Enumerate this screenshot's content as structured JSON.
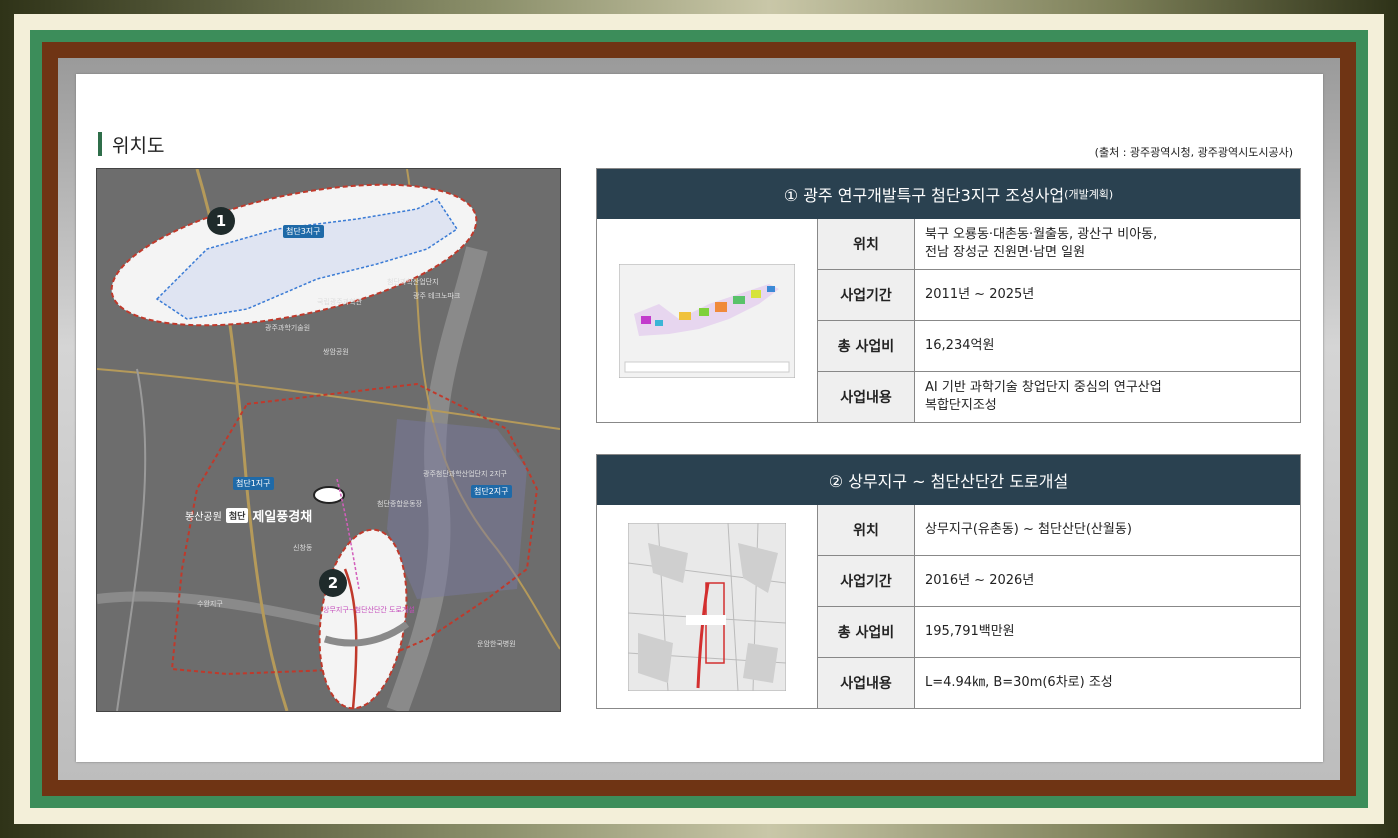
{
  "section": {
    "title": "위치도",
    "source": "(출처 : 광주광역시청, 광주광역시도시공사)"
  },
  "map": {
    "marker1": "1",
    "marker2": "2",
    "badges": {
      "zone3": "첨단3지구",
      "zone1": "첨단1지구",
      "zone2": "첨단2지구"
    },
    "location": {
      "park": "봉산공원",
      "tag": "첨단",
      "company": "제일풍경채"
    },
    "labels": {
      "l1": "국립광주과학관",
      "l2": "광주과학기술원",
      "l3": "첨단과학산업단지",
      "l4": "광주 테크노파크",
      "l5": "수완지구",
      "l6": "신창동",
      "l7": "운암한국병원",
      "l8": "첨단종합운동장",
      "l9": "쌍암공원",
      "l10": "광주첨단과학산업단지 2지구"
    },
    "project_label": "상무지구~첨단산단간 도로개설"
  },
  "projects": [
    {
      "title": "① 광주 연구개발특구 첨단3지구 조성사업",
      "title_note": "(개발계획)",
      "rows": [
        {
          "label": "위치",
          "value": "북구 오룡동·대촌동·월출동, 광산구 비아동,\n전남 장성군 진원면·남면 일원"
        },
        {
          "label": "사업기간",
          "value": "2011년 ~ 2025년"
        },
        {
          "label": "총 사업비",
          "value": "16,234억원"
        },
        {
          "label": "사업내용",
          "value": "AI 기반 과학기술 창업단지 중심의 연구산업\n복합단지조성"
        }
      ]
    },
    {
      "title": "② 상무지구 ~ 첨단산단간 도로개설",
      "title_note": "",
      "rows": [
        {
          "label": "위치",
          "value": "상무지구(유촌동) ~ 첨단산단(산월동)"
        },
        {
          "label": "사업기간",
          "value": "2016년 ~ 2026년"
        },
        {
          "label": "총 사업비",
          "value": "195,791백만원"
        },
        {
          "label": "사업내용",
          "value": "L=4.94㎞, B=30m(6차로) 조성"
        }
      ]
    }
  ],
  "colors": {
    "header": "#2a4150",
    "accent_bar": "#2f6e4a",
    "highlight_outline": "#c0392b"
  }
}
